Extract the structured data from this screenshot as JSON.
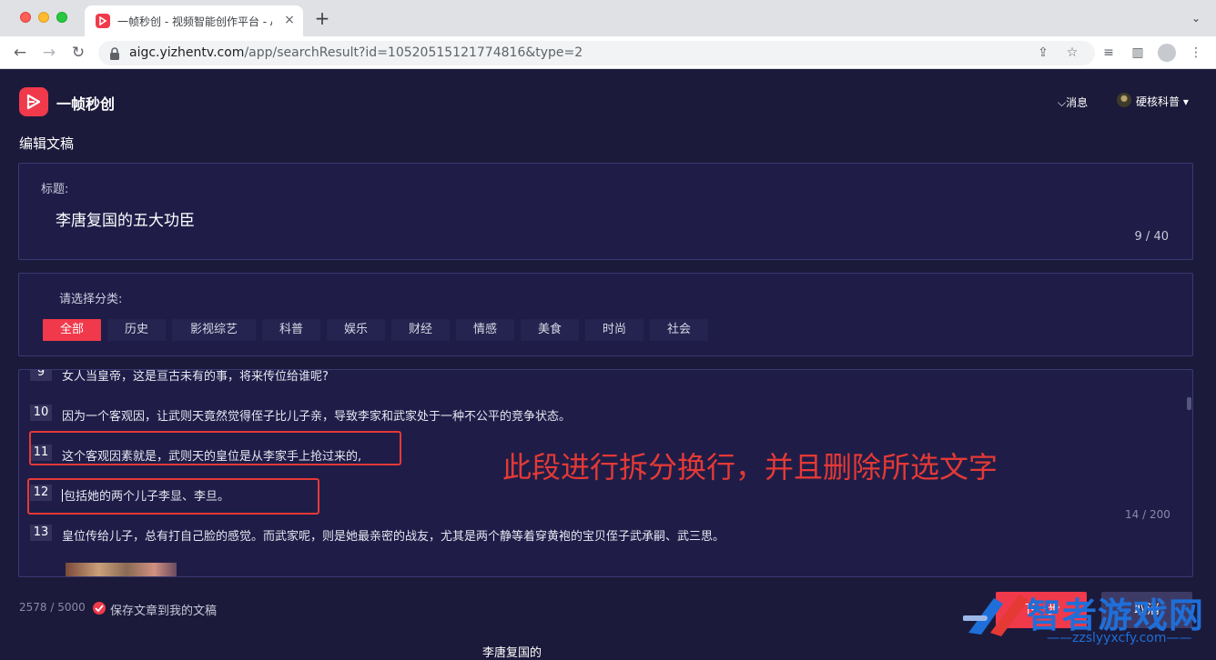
{
  "browser": {
    "tab_title": "一帧秒创 - 视频智能创作平台 - AI",
    "tab_close": "×",
    "new_tab": "+",
    "tab_menu": "⌄",
    "url_host": "aigc.yizhentv.com",
    "url_path": "/app/searchResult?id=10520515121774816&type=2"
  },
  "header": {
    "app_name": "一帧秒创",
    "messages_label": "消息",
    "user_name": "硬核科普"
  },
  "page": {
    "title": "编辑文稿"
  },
  "title_section": {
    "label": "标题:",
    "value": "李唐复国的五大功臣",
    "char_count": "9 / 40"
  },
  "category_section": {
    "label": "请选择分类:",
    "categories": [
      "全部",
      "历史",
      "影视综艺",
      "科普",
      "娱乐",
      "财经",
      "情感",
      "美食",
      "时尚",
      "社会"
    ],
    "selected": "全部"
  },
  "editor": {
    "paragraphs": [
      {
        "num": "9",
        "text": "女人当皇帝，这是亘古未有的事，将来传位给谁呢?"
      },
      {
        "num": "10",
        "text": "因为一个客观因，让武则天竟然觉得侄子比儿子亲，导致李家和武家处于一种不公平的竞争状态。"
      },
      {
        "num": "11",
        "text": "这个客观因素就是，武则天的皇位是从李家手上抢过来的,"
      },
      {
        "num": "12",
        "text": "包括她的两个儿子李显、李旦。"
      },
      {
        "num": "13",
        "text": "皇位传给儿子，总有打自己脸的感觉。而武家呢，则是她最亲密的战友，尤其是两个静等着穿黄袍的宝贝侄子武承嗣、武三思。"
      }
    ],
    "para_char_count": "14 / 200",
    "annotation": "此段进行拆分换行，并且删除所选文字"
  },
  "footer": {
    "word_count": "2578 / 5000",
    "save_label": "保存文章到我的文稿",
    "next_label": "下一步",
    "other_label": "取消",
    "bottom_text": "李唐复国的"
  },
  "watermark": {
    "title": "智者游戏网",
    "url": "——zzslyyxcfy.com——"
  },
  "colors": {
    "accent": "#f0394b",
    "background": "#1c1a3a",
    "panel": "#1f1d48",
    "annotation": "#e53935"
  }
}
